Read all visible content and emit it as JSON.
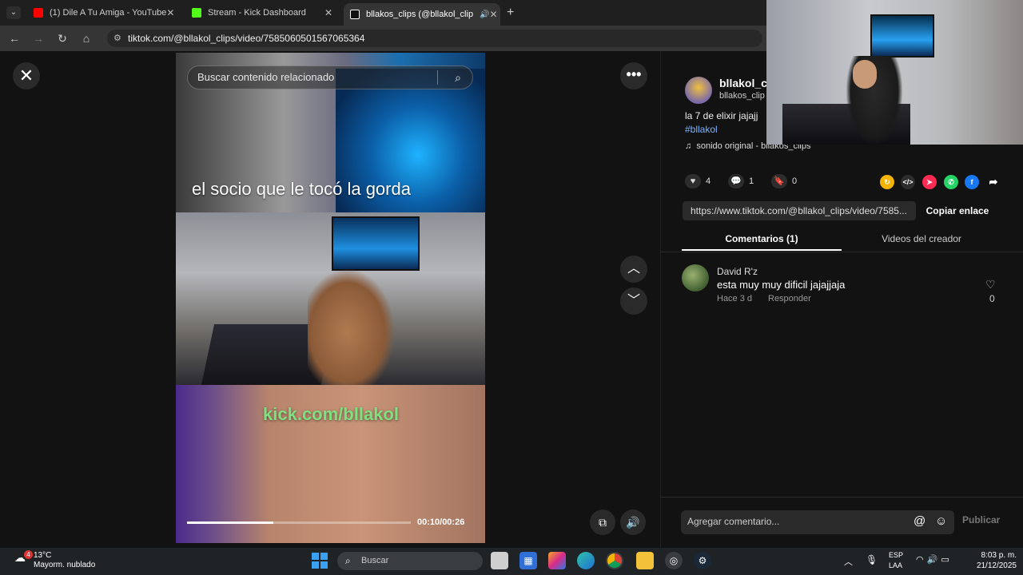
{
  "browser": {
    "tabs": [
      {
        "title": "(1) Dile A Tu Amiga - YouTube",
        "icon": "youtube-icon",
        "color": "#ff0000"
      },
      {
        "title": "Stream - Kick Dashboard",
        "icon": "kick-icon",
        "color": "#53fc18"
      },
      {
        "title": "bllakos_clips (@bllakol_clip",
        "icon": "tiktok-icon",
        "color": "#ffffff"
      }
    ],
    "url": "tiktok.com/@bllakol_clips/video/7585060501567065364"
  },
  "video": {
    "search_placeholder": "Buscar contenido relacionado",
    "caption_top": "el socio que le tocó la gorda",
    "caption_bottom": "kick.com/bllakol",
    "timecode": "00:10/00:26",
    "progress": 0.385
  },
  "post": {
    "username": "bllakol_c",
    "handle": "bllakos_clip",
    "description": "la 7 de elixir jajajj",
    "hashtag": "#bllakol",
    "music": "sonido original - bllakos_clips",
    "likes": "4",
    "comments": "1",
    "saves": "0",
    "link": "https://www.tiktok.com/@bllakol_clips/video/7585...",
    "copy_label": "Copiar enlace",
    "tab_comments": "Comentarios (1)",
    "tab_videos": "Videos del creador",
    "share_colors": [
      "#f4b400",
      "#2d2d2d",
      "#fe2c55",
      "#25d366",
      "#1877f2"
    ]
  },
  "comment": {
    "author": "David R'z",
    "text": "esta muy muy dificil jajajjaja",
    "time": "Hace 3 d",
    "reply": "Responder",
    "likes": "0"
  },
  "composer": {
    "placeholder": "Agregar comentario...",
    "publish": "Publicar"
  },
  "taskbar": {
    "weather_badge": "4",
    "temperature": "13°C",
    "weather": "Mayorm. nublado",
    "search": "Buscar",
    "lang1": "ESP",
    "lang2": "LAA",
    "time": "8:03 p. m.",
    "date": "21/12/2025"
  }
}
